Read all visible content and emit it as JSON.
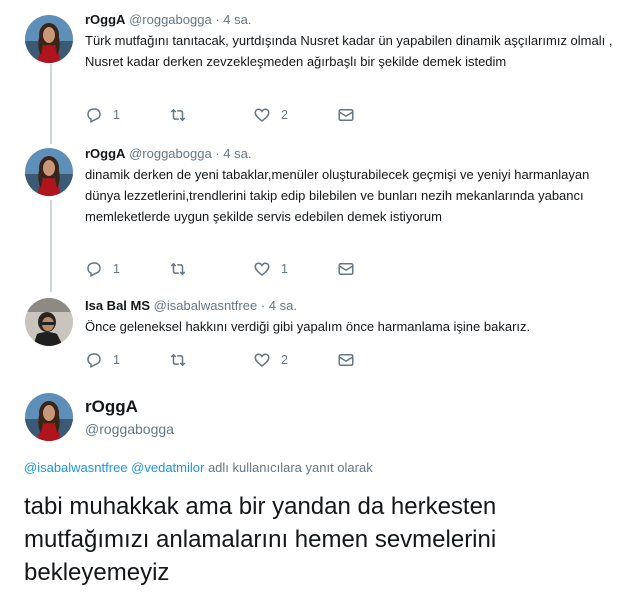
{
  "tweets": [
    {
      "name": "rOggA",
      "handle": "@roggabogga",
      "separator": "·",
      "time": "4 sa.",
      "text": "Türk mutfağını tanıtacak, yurtdışında Nusret kadar ün yapabilen dinamik aşçılarımız olmalı , Nusret kadar derken zevzekleşmeden ağırbaşlı bir şekilde demek istedim",
      "replies": "1",
      "retweets": "",
      "likes": "2"
    },
    {
      "name": "rOggA",
      "handle": "@roggabogga",
      "separator": "·",
      "time": "4 sa.",
      "text": "dinamik derken de yeni tabaklar,menüler oluşturabilecek geçmişi ve yeniyi harmanlayan dünya lezzetlerini,trendlerini takip edip bilebilen ve bunları nezih mekanlarında yabancı memleketlerde uygun şekilde servis edebilen demek istiyorum",
      "replies": "1",
      "retweets": "",
      "likes": "1"
    },
    {
      "name": "Isa Bal MS",
      "handle": "@isabalwasntfree",
      "separator": "·",
      "time": "4 sa.",
      "text": "Önce geleneksel hakkını verdiği gibi yapalım önce harmanlama işine bakarız.",
      "replies": "1",
      "retweets": "",
      "likes": "2"
    }
  ],
  "main_tweet": {
    "name": "rOggA",
    "handle": "@roggabogga",
    "reply_mention_1": "@isabalwasntfree",
    "reply_mention_2": "@vedatmilor",
    "reply_suffix": "adlı kullanıcılara yanıt olarak",
    "text": "tabi muhakkak ama bir yandan da herkesten mutfağımızı anlamalarını hemen sevmelerini bekleyemeyiz"
  },
  "colors": {
    "link": "#1b95e0",
    "muted": "#657786",
    "thread_line": "#ccd6dd"
  },
  "icons": [
    "reply-icon",
    "retweet-icon",
    "like-icon",
    "dm-icon"
  ]
}
